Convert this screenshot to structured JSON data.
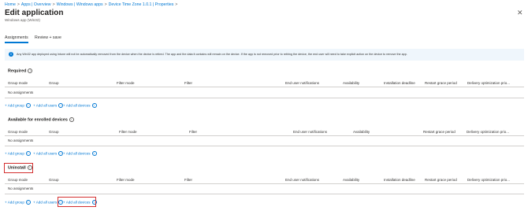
{
  "breadcrumb": [
    "Home",
    "Apps | Overview",
    "Windows | Windows apps",
    "Device Time Zone 1.0.1 | Properties"
  ],
  "header": {
    "title": "Edit application",
    "subtitle": "Windows app (Win32)",
    "more": "···",
    "close": "✕"
  },
  "tabs": [
    {
      "label": "Assignments",
      "active": true
    },
    {
      "label": "Review + save",
      "active": false
    }
  ],
  "banner": {
    "text": "Any Win32 app deployed using Intune will not be automatically removed from the device when the device is retired. The app and the data it contains will remain on the device. If the app is not removed prior to retiring the device, the end user will need to take explicit action on the device to remove the app."
  },
  "columns": [
    "Group mode",
    "Group",
    "Filter mode",
    "Filter",
    "End user notifications",
    "Availability",
    "Installation deadline",
    "Restart grace period",
    "Delivery optimization prio..."
  ],
  "sections": [
    {
      "title": "Required",
      "empty_text": "No assignments"
    },
    {
      "title": "Available for enrolled devices",
      "empty_text": "No assignments"
    },
    {
      "title": "Uninstall",
      "empty_text": "No assignments"
    }
  ],
  "links": {
    "add_group": "+ Add group",
    "add_all_users": "+ Add all users",
    "add_all_devices": "+ Add all devices"
  },
  "colors": {
    "accent": "#0078d4",
    "highlight": "#d32f2f",
    "banner_bg": "#eff6fc"
  }
}
